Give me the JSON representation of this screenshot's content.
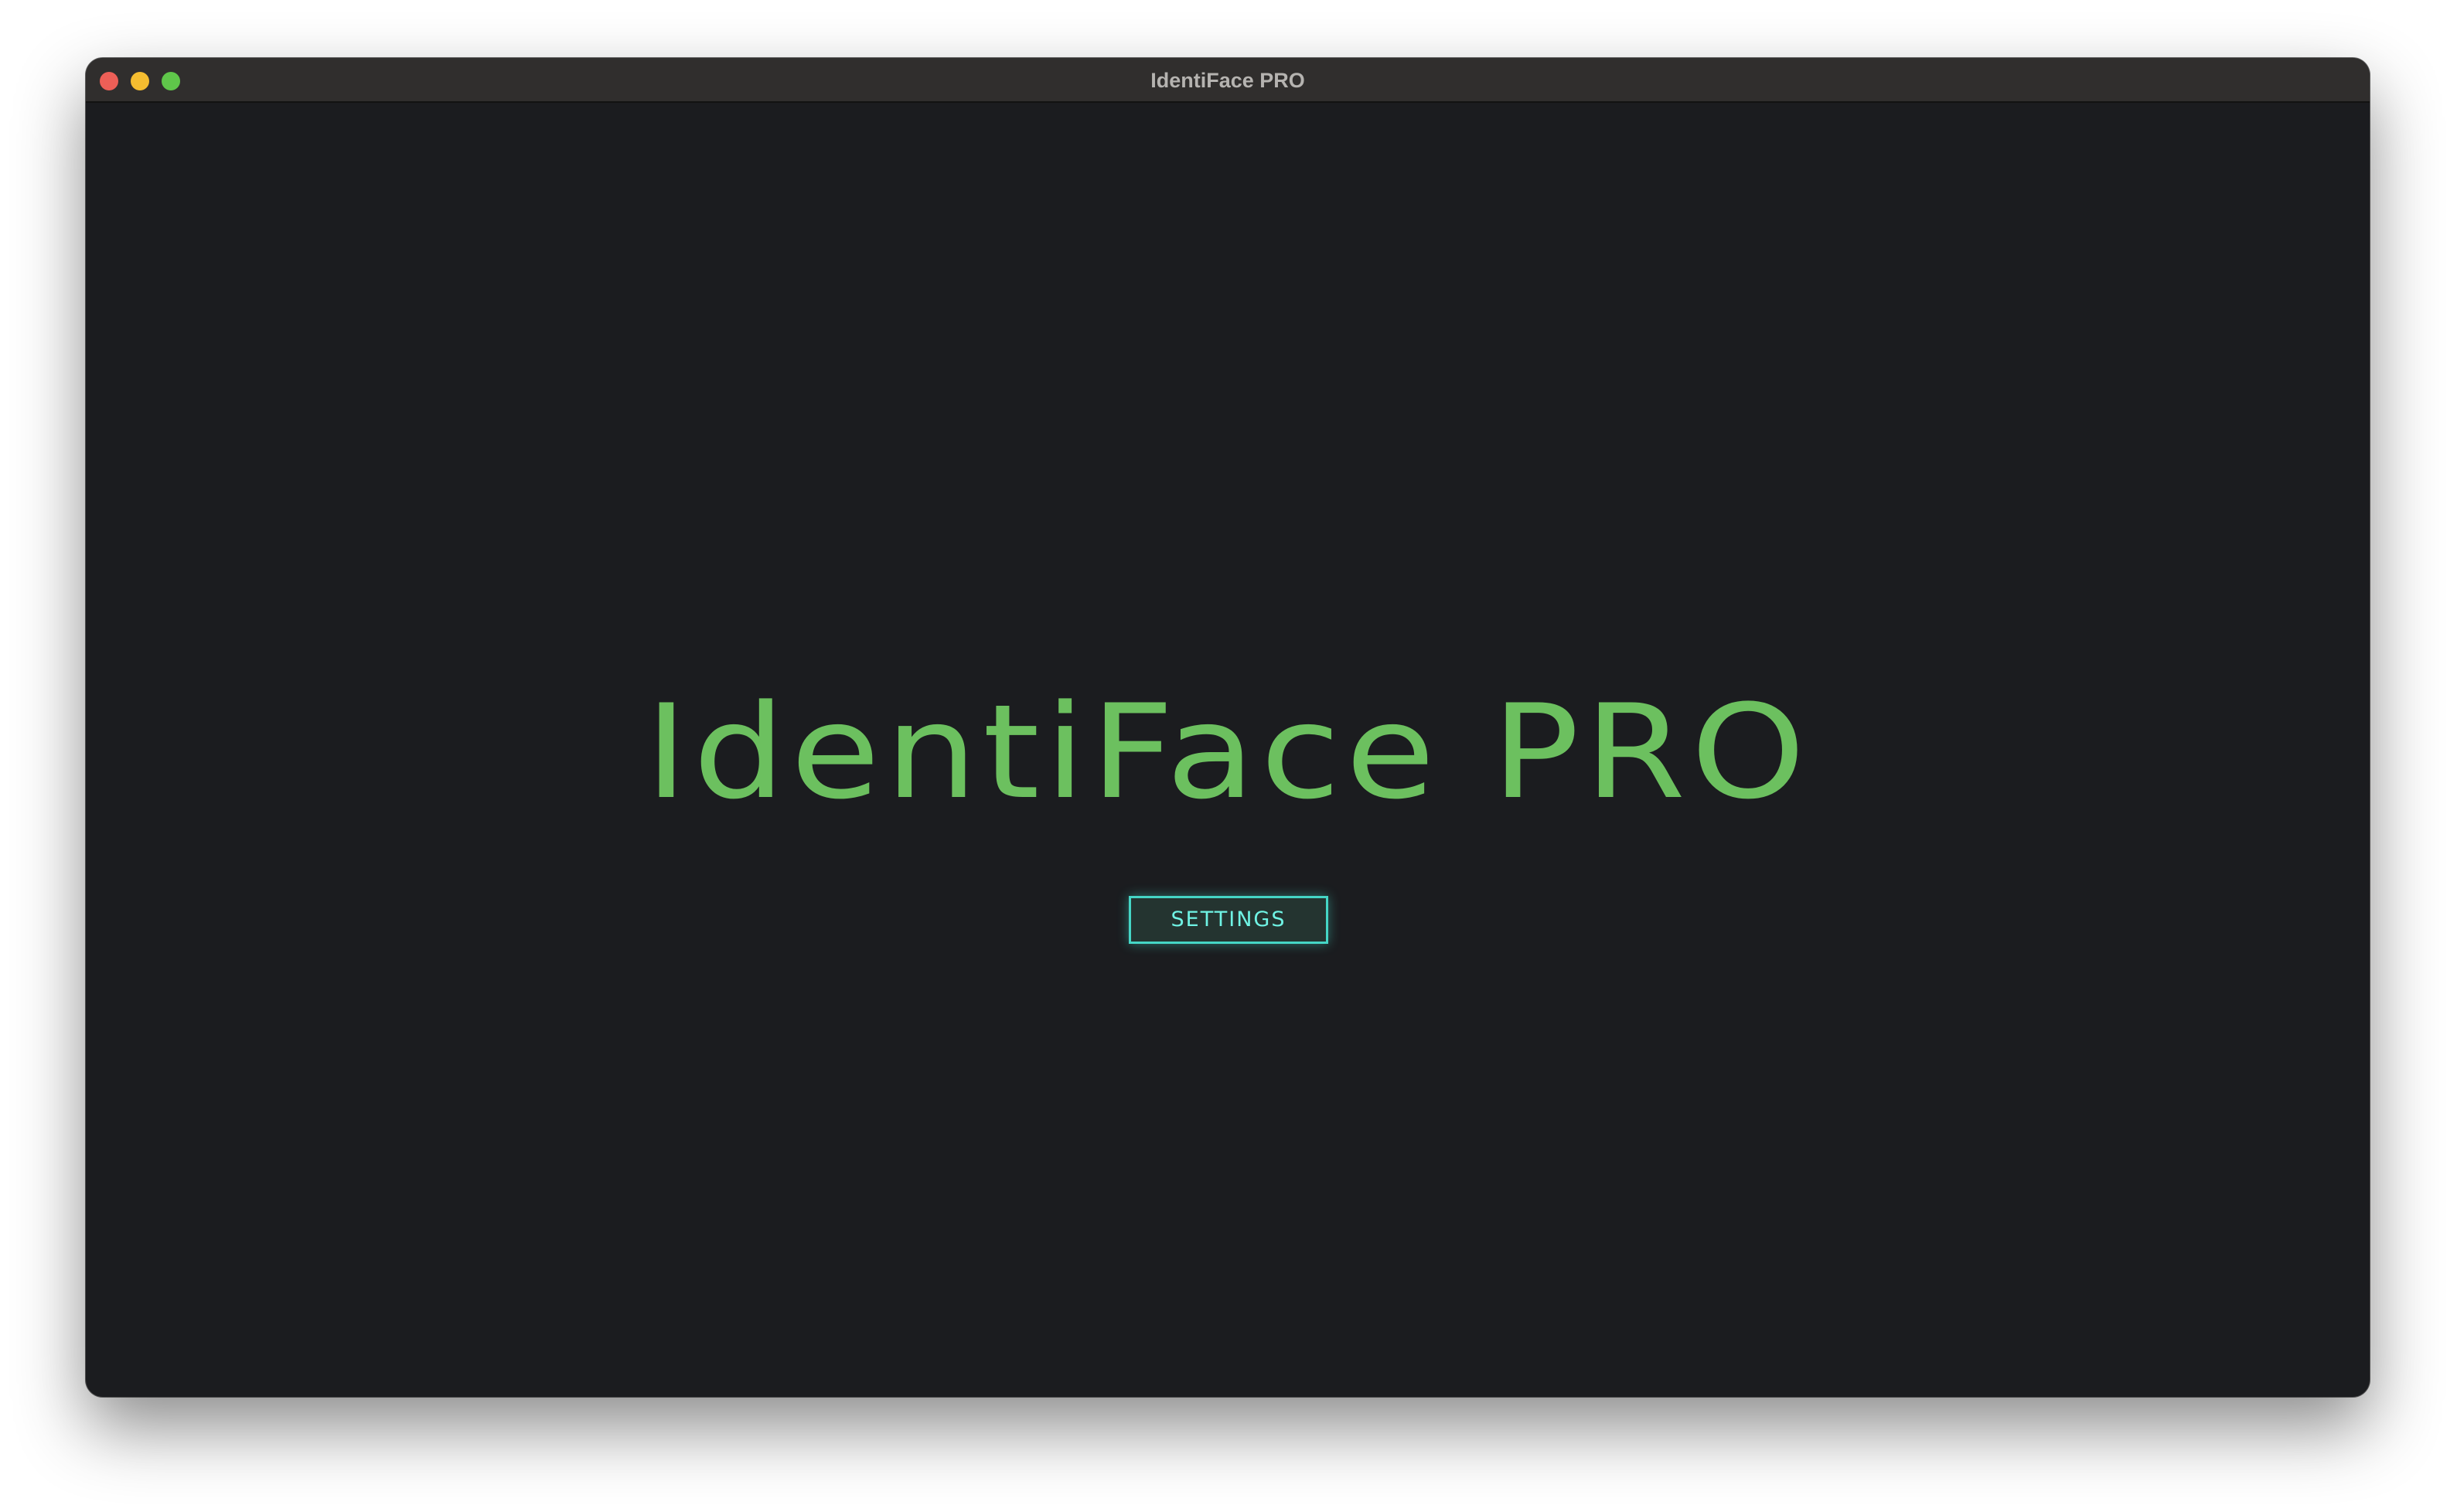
{
  "window": {
    "title": "IdentiFace PRO"
  },
  "main": {
    "heading": "IdentiFace PRO",
    "settings_label": "SETTINGS"
  },
  "colors": {
    "background": "#1b1c1f",
    "titlebar": "#302e2d",
    "heading": "#6cc05f",
    "button_border": "#45d6c6",
    "button_text": "#6ff3e4"
  }
}
